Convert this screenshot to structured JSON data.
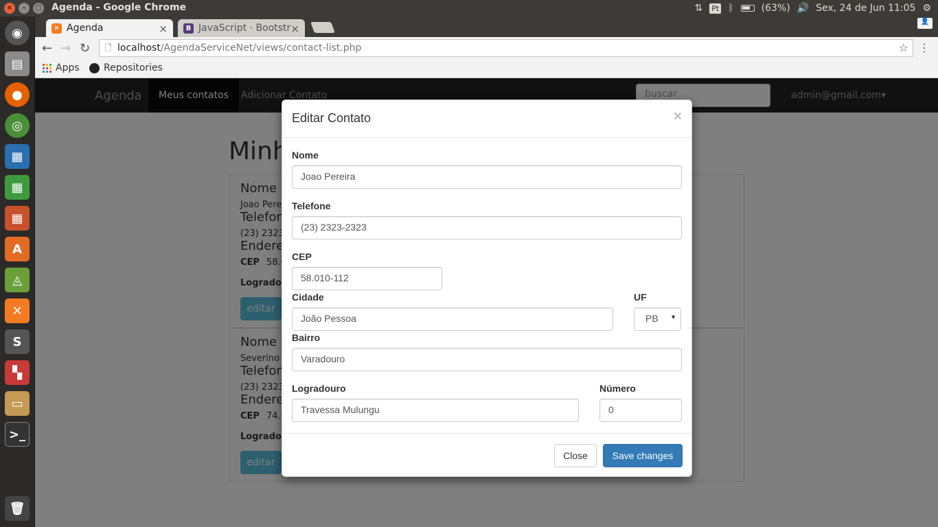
{
  "window": {
    "title": "Agenda - Google Chrome"
  },
  "tray": {
    "pt": "Pt",
    "battery": "(63%)",
    "datetime": "Sex, 24 de Jun 11:05"
  },
  "tabs": [
    {
      "label": "Agenda",
      "favicon": "xampp-icon"
    },
    {
      "label": "JavaScript · Bootstr",
      "favicon": "bootstrap-icon"
    }
  ],
  "address": {
    "host": "localhost",
    "path": "/AgendaServiceNet/views/contact-list.php"
  },
  "bookmarks": {
    "apps": "Apps",
    "repositories": "Repositories"
  },
  "navbar": {
    "brand": "Agenda",
    "meus": "Meus contatos",
    "adicionar": "Adicionar Contato",
    "search_placeholder": "buscar",
    "user": "admin@gmail.com▾"
  },
  "page": {
    "title": "Minh"
  },
  "cards": [
    {
      "nome_h": "Nome",
      "nome": "Joao Pere",
      "tel_h": "Telefone",
      "tel": "(23) 2323",
      "end_h": "Endere",
      "cep_lbl": "CEP",
      "cep": "58.0",
      "log_lbl": "Logradou",
      "btn": "editar"
    },
    {
      "nome_h": "Nome",
      "nome": "Severino .",
      "tel_h": "Telefone",
      "tel": "(23) 2323",
      "end_h": "Endere",
      "cep_lbl": "CEP",
      "cep": "74.9",
      "log_lbl": "Logradou",
      "btn": "editar"
    }
  ],
  "modal": {
    "title": "Editar Contato",
    "close_x": "×",
    "labels": {
      "nome": "Nome",
      "telefone": "Telefone",
      "cep": "CEP",
      "cidade": "Cidade",
      "uf": "UF",
      "bairro": "Bairro",
      "logradouro": "Logradouro",
      "numero": "Número"
    },
    "values": {
      "nome": "Joao Pereira",
      "telefone": "(23) 2323-2323",
      "cep": "58.010-112",
      "cidade": "João Pessoa",
      "uf": "PB",
      "bairro": "Varadouro",
      "logradouro": "Travessa Mulungu",
      "numero": "0"
    },
    "buttons": {
      "close": "Close",
      "save": "Save changes"
    }
  },
  "colors": {
    "primary": "#337ab7",
    "info": "#5bc0de",
    "navbar": "#222222"
  }
}
